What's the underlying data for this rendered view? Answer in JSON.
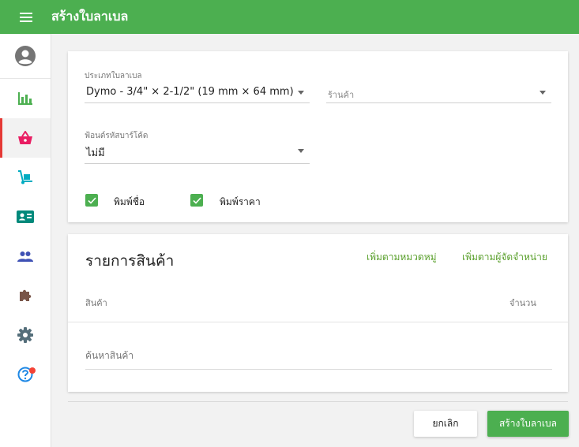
{
  "appbar": {
    "title": "สร้างใบลาเบล",
    "color": "#4caf50"
  },
  "sidebar": {
    "items": [
      {
        "icon": "account-circle-icon",
        "active": false
      },
      {
        "icon": "bar-chart-icon",
        "color": "#4caf50",
        "active": false
      },
      {
        "icon": "basket-icon",
        "color": "#e91e63",
        "active": true
      },
      {
        "icon": "hand-truck-icon",
        "color": "#00acc1",
        "active": false
      },
      {
        "icon": "contact-card-icon",
        "color": "#00897b",
        "active": false
      },
      {
        "icon": "people-icon",
        "color": "#3f51b5",
        "active": false
      },
      {
        "icon": "puzzle-icon",
        "color": "#795548",
        "active": false
      },
      {
        "icon": "gear-icon",
        "color": "#546e7a",
        "active": false
      },
      {
        "icon": "help-icon",
        "color": "#1e88e5",
        "badge": true,
        "active": false
      }
    ]
  },
  "form": {
    "label_type": {
      "label": "ประเภทใบลาเบล",
      "value": "Dymo - 3/4\" × 2-1/2\" (19 mm × 64 mm)"
    },
    "store": {
      "placeholder": "ร้านค้า"
    },
    "barcode_font": {
      "label": "ฟ้อนต์รหัสบาร์โค้ด",
      "value": "ไม่มี"
    },
    "print_name": {
      "label": "พิมพ์ชื่อ",
      "checked": true
    },
    "print_price": {
      "label": "พิมพ์ราคา",
      "checked": true
    }
  },
  "items_card": {
    "title": "รายการสินค้า",
    "add_by_category": "เพิ่มตามหมวดหมู่",
    "add_by_supplier": "เพิ่มตามผู้จัดจำหน่าย",
    "columns": {
      "product": "สินค้า",
      "quantity": "จำนวน"
    },
    "search_placeholder": "ค้นหาสินค้า"
  },
  "footer": {
    "cancel_label": "ยกเลิก",
    "create_label": "สร้างใบลาเบล"
  }
}
